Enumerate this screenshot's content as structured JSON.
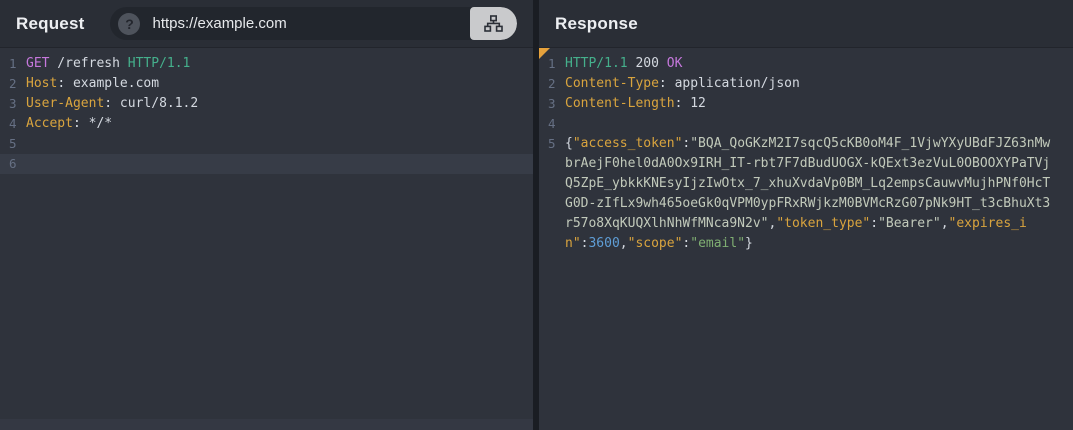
{
  "theme": {
    "editor_bg": "#2f333c",
    "header_bg": "#2a2e36",
    "divider": "#1a1d23",
    "active_line_bg": "#373c47",
    "line_number_color": "#667084",
    "syntax": {
      "keyword_purple": "#c678dd",
      "http_version_green": "#45b08c",
      "header_key_orange": "#d9a43e",
      "default_text": "#d4d9e0",
      "string_pale": "#c2cabb",
      "string_green": "#7fae72",
      "number_blue": "#5f9ed6",
      "marker_orange": "#e6a23c"
    }
  },
  "request": {
    "title": "Request",
    "url_bar": {
      "help_icon": "question-mark-icon",
      "url": "https://example.com",
      "send_icon": "sitemap-icon"
    },
    "editor": {
      "lines": [
        {
          "num": "1",
          "tokens": [
            "GET",
            " /refresh ",
            "HTTP/1.1"
          ]
        },
        {
          "num": "2",
          "tokens": [
            "Host",
            ": example.com"
          ]
        },
        {
          "num": "3",
          "tokens": [
            "User-Agent",
            ": curl/8.1.2"
          ]
        },
        {
          "num": "4",
          "tokens": [
            "Accept",
            ": */*"
          ]
        },
        {
          "num": "5",
          "tokens": []
        },
        {
          "num": "6",
          "tokens": []
        }
      ]
    }
  },
  "response": {
    "title": "Response",
    "editor": {
      "lines": [
        {
          "num": "1",
          "tokens": [
            "HTTP/1.1",
            " 200 ",
            "OK"
          ]
        },
        {
          "num": "2",
          "tokens": [
            "Content-Type",
            ": application/json"
          ]
        },
        {
          "num": "3",
          "tokens": [
            "Content-Length",
            ": 12"
          ]
        },
        {
          "num": "4",
          "tokens": []
        },
        {
          "num": "5",
          "tokens": [
            "{",
            "\"access_token\"",
            ":",
            "\"BQA_QoGKzM2I7sqcQ5cKB0oM4F_1VjwYXyUBdFJZ63nMwbrAejF0hel0dA0Ox9IRH_IT-rbt7F7dBudUOGX-kQExt3ezVuL0OBOOXYPaTVjQ5ZpE_ybkkKNEsyIjzIwOtx_7_xhuXvdaVp0BM_Lq2empsCauwvMujhPNf0HcTG0D-zIfLx9wh465oeGk0qVPM0ypFRxRWjkzM0BVMcRzG07pNk9HT_t3cBhuXt3r57o8XqKUQXlhNhWfMNca9N2v\"",
            ",",
            "\"token_type\"",
            ":",
            "\"Bearer\"",
            ",",
            "\"expires_in\"",
            ":",
            "3600",
            ",",
            "\"scope\"",
            ":",
            "\"email\"",
            "}"
          ]
        }
      ]
    }
  }
}
